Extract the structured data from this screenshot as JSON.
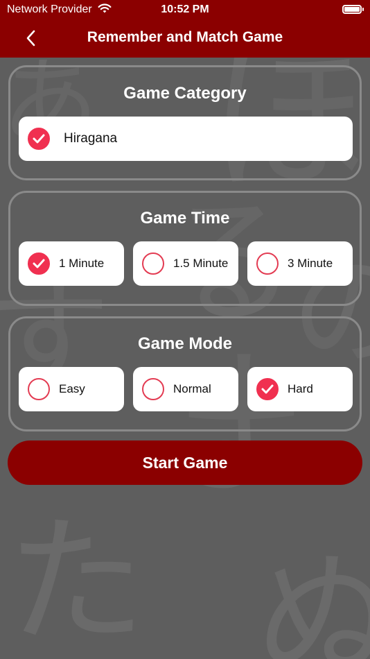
{
  "status_bar": {
    "carrier": "Network Provider",
    "time": "10:52 PM"
  },
  "nav": {
    "title": "Remember and Match Game"
  },
  "background_kana": [
    "あ",
    "ほ",
    "る",
    "す",
    "の",
    "ま",
    "た",
    "ぬ"
  ],
  "sections": {
    "category": {
      "title": "Game Category",
      "options": [
        {
          "label": "Hiragana",
          "checked": true
        }
      ]
    },
    "time": {
      "title": "Game Time",
      "options": [
        {
          "label": "1 Minute",
          "checked": true
        },
        {
          "label": "1.5 Minute",
          "checked": false
        },
        {
          "label": "3 Minute",
          "checked": false
        }
      ]
    },
    "mode": {
      "title": "Game Mode",
      "options": [
        {
          "label": "Easy",
          "checked": false
        },
        {
          "label": "Normal",
          "checked": false
        },
        {
          "label": "Hard",
          "checked": true
        }
      ]
    }
  },
  "start_button": {
    "label": "Start Game"
  },
  "colors": {
    "header": "#8b0000",
    "background": "#5e5e5e",
    "accent": "#f03050"
  }
}
